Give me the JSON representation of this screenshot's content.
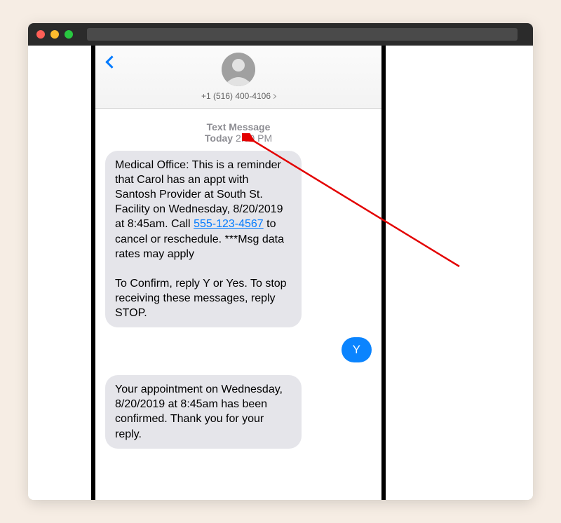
{
  "header": {
    "phone_number": "+1 (516) 400-4106"
  },
  "meta": {
    "label": "Text Message",
    "day": "Today",
    "time": "2:30 PM"
  },
  "messages": {
    "m1_pre": "Medical Office: This is a reminder that Carol has an appt with Santosh Provider at South St. Facility on Wednesday, 8/20/2019 at 8:45am.  Call ",
    "m1_link": "555-123-4567",
    "m1_post": " to cancel or reschedule. ***Msg data rates may apply",
    "m1_p2": "To Confirm, reply Y or Yes. To stop receiving these messages, reply STOP.",
    "reply": "Y",
    "m2": "Your appointment on Wednesday, 8/20/2019 at 8:45am has been confirmed. Thank you for your reply."
  }
}
